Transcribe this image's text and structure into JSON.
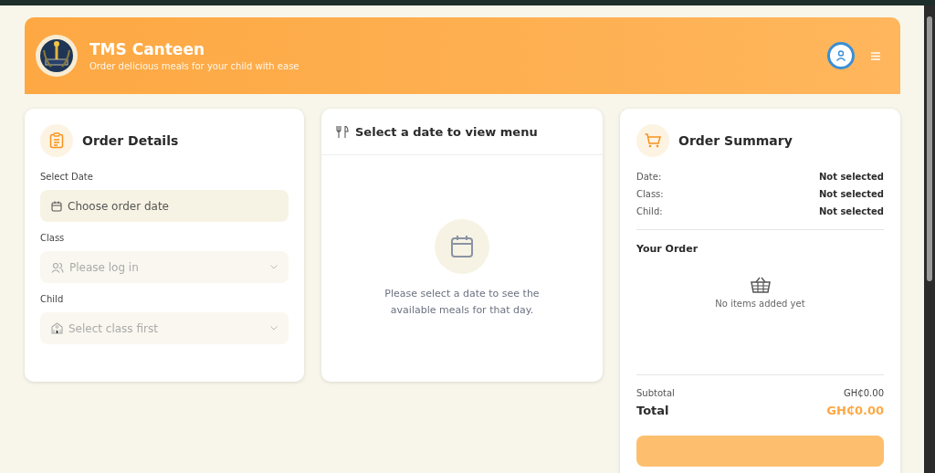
{
  "header": {
    "title": "TMS Canteen",
    "subtitle": "Order delicious meals for your child with ease"
  },
  "order_details": {
    "title": "Order Details",
    "fields": [
      {
        "label": "Select Date",
        "placeholder": "Choose order date",
        "kind": "date",
        "disabled": false
      },
      {
        "label": "Class",
        "placeholder": "Please log in",
        "kind": "class",
        "disabled": true
      },
      {
        "label": "Child",
        "placeholder": "Select class first",
        "kind": "child",
        "disabled": true
      }
    ]
  },
  "menu": {
    "title": "Select a date to view menu",
    "message": "Please select a date to see the available meals for that day."
  },
  "summary": {
    "title": "Order Summary",
    "rows": [
      {
        "label": "Date:",
        "value": "Not selected"
      },
      {
        "label": "Class:",
        "value": "Not selected"
      },
      {
        "label": "Child:",
        "value": "Not selected"
      }
    ],
    "your_order": "Your Order",
    "empty": "No items added yet",
    "subtotal_label": "Subtotal",
    "subtotal": "GH₵0.00",
    "total_label": "Total",
    "total": "GH₵0.00"
  }
}
